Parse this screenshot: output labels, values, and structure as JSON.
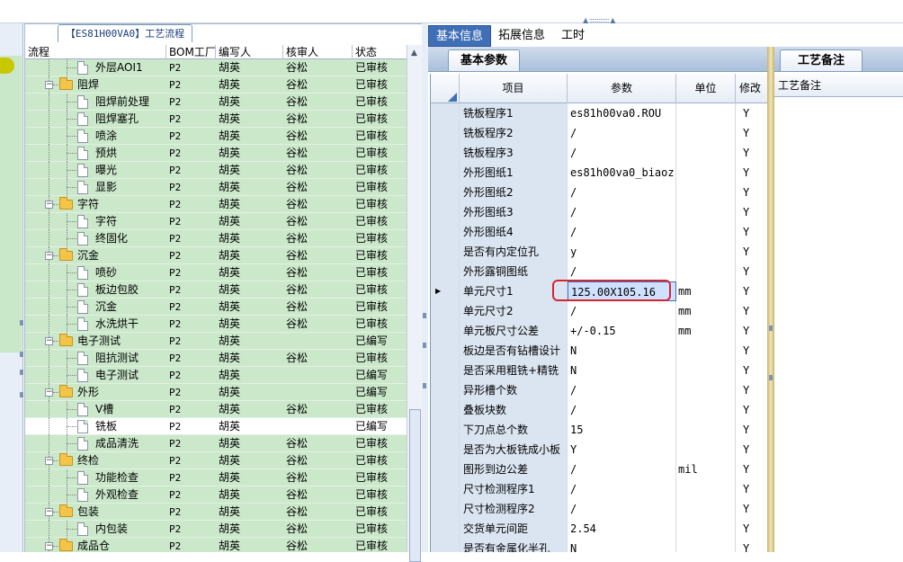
{
  "tree": {
    "tab_label": "【ES81H00VA0】工艺流程",
    "columns": [
      "流程",
      "BOM工厂",
      "编写人",
      "核审人",
      "状态"
    ],
    "rows": [
      {
        "level": 2,
        "type": "doc",
        "name": "外层AOI1",
        "bom": "P2",
        "author": "胡英",
        "reviewer": "谷松",
        "status": "已审核"
      },
      {
        "level": 1,
        "type": "folder",
        "name": "阻焊",
        "bom": "P2",
        "author": "胡英",
        "reviewer": "谷松",
        "status": "已审核"
      },
      {
        "level": 2,
        "type": "doc",
        "name": "阻焊前处理",
        "bom": "P2",
        "author": "胡英",
        "reviewer": "谷松",
        "status": "已审核"
      },
      {
        "level": 2,
        "type": "doc",
        "name": "阻焊塞孔",
        "bom": "P2",
        "author": "胡英",
        "reviewer": "谷松",
        "status": "已审核"
      },
      {
        "level": 2,
        "type": "doc",
        "name": "喷涂",
        "bom": "P2",
        "author": "胡英",
        "reviewer": "谷松",
        "status": "已审核"
      },
      {
        "level": 2,
        "type": "doc",
        "name": "预烘",
        "bom": "P2",
        "author": "胡英",
        "reviewer": "谷松",
        "status": "已审核"
      },
      {
        "level": 2,
        "type": "doc",
        "name": "曝光",
        "bom": "P2",
        "author": "胡英",
        "reviewer": "谷松",
        "status": "已审核"
      },
      {
        "level": 2,
        "type": "doc",
        "name": "显影",
        "bom": "P2",
        "author": "胡英",
        "reviewer": "谷松",
        "status": "已审核"
      },
      {
        "level": 1,
        "type": "folder",
        "name": "字符",
        "bom": "P2",
        "author": "胡英",
        "reviewer": "谷松",
        "status": "已审核"
      },
      {
        "level": 2,
        "type": "doc",
        "name": "字符",
        "bom": "P2",
        "author": "胡英",
        "reviewer": "谷松",
        "status": "已审核"
      },
      {
        "level": 2,
        "type": "doc",
        "name": "终固化",
        "bom": "P2",
        "author": "胡英",
        "reviewer": "谷松",
        "status": "已审核"
      },
      {
        "level": 1,
        "type": "folder",
        "name": "沉金",
        "bom": "P2",
        "author": "胡英",
        "reviewer": "谷松",
        "status": "已审核"
      },
      {
        "level": 2,
        "type": "doc",
        "name": "喷砂",
        "bom": "P2",
        "author": "胡英",
        "reviewer": "谷松",
        "status": "已审核"
      },
      {
        "level": 2,
        "type": "doc",
        "name": "板边包胶",
        "bom": "P2",
        "author": "胡英",
        "reviewer": "谷松",
        "status": "已审核"
      },
      {
        "level": 2,
        "type": "doc",
        "name": "沉金",
        "bom": "P2",
        "author": "胡英",
        "reviewer": "谷松",
        "status": "已审核"
      },
      {
        "level": 2,
        "type": "doc",
        "name": "水洗烘干",
        "bom": "P2",
        "author": "胡英",
        "reviewer": "谷松",
        "status": "已审核"
      },
      {
        "level": 1,
        "type": "folder",
        "name": "电子测试",
        "bom": "P2",
        "author": "胡英",
        "reviewer": "",
        "status": "已编写"
      },
      {
        "level": 2,
        "type": "doc",
        "name": "阻抗测试",
        "bom": "P2",
        "author": "胡英",
        "reviewer": "谷松",
        "status": "已审核"
      },
      {
        "level": 2,
        "type": "doc",
        "name": "电子测试",
        "bom": "P2",
        "author": "胡英",
        "reviewer": "",
        "status": "已编写"
      },
      {
        "level": 1,
        "type": "folder",
        "name": "外形",
        "bom": "P2",
        "author": "胡英",
        "reviewer": "",
        "status": "已编写"
      },
      {
        "level": 2,
        "type": "doc",
        "name": "V槽",
        "bom": "P2",
        "author": "胡英",
        "reviewer": "谷松",
        "status": "已审核"
      },
      {
        "level": 2,
        "type": "doc",
        "name": "铣板",
        "bom": "P2",
        "author": "胡英",
        "reviewer": "",
        "status": "已编写",
        "selected": true
      },
      {
        "level": 2,
        "type": "doc",
        "name": "成品清洗",
        "bom": "P2",
        "author": "胡英",
        "reviewer": "谷松",
        "status": "已审核"
      },
      {
        "level": 1,
        "type": "folder",
        "name": "终检",
        "bom": "P2",
        "author": "胡英",
        "reviewer": "谷松",
        "status": "已审核"
      },
      {
        "level": 2,
        "type": "doc",
        "name": "功能检查",
        "bom": "P2",
        "author": "胡英",
        "reviewer": "谷松",
        "status": "已审核"
      },
      {
        "level": 2,
        "type": "doc",
        "name": "外观检查",
        "bom": "P2",
        "author": "胡英",
        "reviewer": "谷松",
        "status": "已审核"
      },
      {
        "level": 1,
        "type": "folder",
        "name": "包装",
        "bom": "P2",
        "author": "胡英",
        "reviewer": "谷松",
        "status": "已审核"
      },
      {
        "level": 2,
        "type": "doc",
        "name": "内包装",
        "bom": "P2",
        "author": "胡英",
        "reviewer": "谷松",
        "status": "已审核"
      },
      {
        "level": 1,
        "type": "folder",
        "name": "成品仓",
        "bom": "P2",
        "author": "胡英",
        "reviewer": "谷松",
        "status": "已审核"
      }
    ]
  },
  "tabs": [
    "基本信息",
    "拓展信息",
    "工时"
  ],
  "subtab": "基本参数",
  "grid": {
    "columns": [
      "项目",
      "参数",
      "单位",
      "修改"
    ],
    "rows": [
      {
        "item": "铣板程序1",
        "param": "es81h00va0.ROU",
        "unit": "",
        "mod": "Y"
      },
      {
        "item": "铣板程序2",
        "param": "/",
        "unit": "",
        "mod": "Y"
      },
      {
        "item": "铣板程序3",
        "param": "/",
        "unit": "",
        "mod": "Y"
      },
      {
        "item": "外形图纸1",
        "param": "es81h00va0_biaoz...",
        "unit": "",
        "mod": "Y"
      },
      {
        "item": "外形图纸2",
        "param": "/",
        "unit": "",
        "mod": "Y"
      },
      {
        "item": "外形图纸3",
        "param": "/",
        "unit": "",
        "mod": "Y"
      },
      {
        "item": "外形图纸4",
        "param": "/",
        "unit": "",
        "mod": "Y"
      },
      {
        "item": "是否有内定位孔",
        "param": "y",
        "unit": "",
        "mod": "Y"
      },
      {
        "item": "外形露铜图纸",
        "param": "/",
        "unit": "",
        "mod": "Y"
      },
      {
        "item": "单元尺寸1",
        "param": "125.00X105.16",
        "unit": "mm",
        "mod": "Y",
        "current": true
      },
      {
        "item": "单元尺寸2",
        "param": "/",
        "unit": "mm",
        "mod": "Y"
      },
      {
        "item": "单元板尺寸公差",
        "param": "+/-0.15",
        "unit": "mm",
        "mod": "Y"
      },
      {
        "item": "板边是否有钻槽设计",
        "param": "N",
        "unit": "",
        "mod": "Y"
      },
      {
        "item": "是否采用粗铣+精铣",
        "param": "N",
        "unit": "",
        "mod": "Y"
      },
      {
        "item": "异形槽个数",
        "param": "/",
        "unit": "",
        "mod": "Y"
      },
      {
        "item": "叠板块数",
        "param": "/",
        "unit": "",
        "mod": "Y"
      },
      {
        "item": "下刀点总个数",
        "param": "15",
        "unit": "",
        "mod": "Y"
      },
      {
        "item": "是否为大板铣成小板",
        "param": "Y",
        "unit": "",
        "mod": "Y"
      },
      {
        "item": "图形到边公差",
        "param": "/",
        "unit": "mil",
        "mod": "Y"
      },
      {
        "item": "尺寸检测程序1",
        "param": "/",
        "unit": "",
        "mod": "Y"
      },
      {
        "item": "尺寸检测程序2",
        "param": "/",
        "unit": "",
        "mod": "Y"
      },
      {
        "item": "交货单元间距",
        "param": "2.54",
        "unit": "",
        "mod": "Y"
      },
      {
        "item": "是否有金属化半孔",
        "param": "N",
        "unit": "",
        "mod": "Y"
      }
    ]
  },
  "notes": {
    "tab": "工艺备注",
    "header": "工艺备注"
  }
}
